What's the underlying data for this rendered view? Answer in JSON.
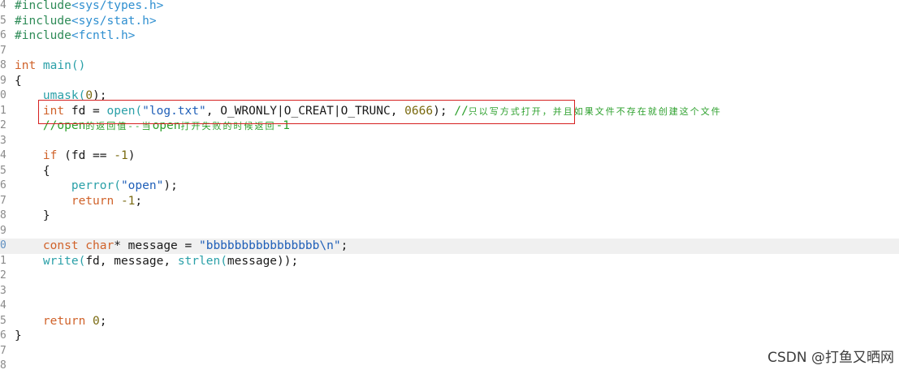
{
  "lines": [
    {
      "num": "4",
      "tokens": [
        {
          "t": "#include",
          "c": "pp"
        },
        {
          "t": "<sys/types.h>",
          "c": "hdr"
        }
      ]
    },
    {
      "num": "5",
      "tokens": [
        {
          "t": "#include",
          "c": "pp"
        },
        {
          "t": "<sys/stat.h>",
          "c": "hdr"
        }
      ]
    },
    {
      "num": "6",
      "tokens": [
        {
          "t": "#include",
          "c": "pp"
        },
        {
          "t": "<fcntl.h>",
          "c": "hdr"
        }
      ]
    },
    {
      "num": "7",
      "tokens": []
    },
    {
      "num": "8",
      "tokens": [
        {
          "t": "int",
          "c": "kw"
        },
        {
          "t": " main()",
          "c": "fn"
        }
      ]
    },
    {
      "num": "9",
      "tokens": [
        {
          "t": "{",
          "c": "id"
        }
      ]
    },
    {
      "num": "0",
      "tokens": [
        {
          "t": "    umask(",
          "c": "fn"
        },
        {
          "t": "0",
          "c": "num"
        },
        {
          "t": ");",
          "c": "id"
        }
      ]
    },
    {
      "num": "1",
      "tokens": [
        {
          "t": "    int",
          "c": "kw"
        },
        {
          "t": " fd = ",
          "c": "id"
        },
        {
          "t": "open(",
          "c": "fn"
        },
        {
          "t": "\"log.txt\"",
          "c": "str"
        },
        {
          "t": ", O_WRONLY|O_CREAT|O_TRUNC, ",
          "c": "id"
        },
        {
          "t": "0666",
          "c": "num"
        },
        {
          "t": "); ",
          "c": "id"
        },
        {
          "t": "//",
          "c": "cmt"
        },
        {
          "t": "只以写方式打开，并且如果文件不存在就创建这个文件",
          "c": "cmt-small"
        }
      ]
    },
    {
      "num": "2",
      "tokens": [
        {
          "t": "    //open",
          "c": "cmt"
        },
        {
          "t": "的返回值--当",
          "c": "cmt-small"
        },
        {
          "t": "open",
          "c": "cmt"
        },
        {
          "t": "打开失败的时候返回",
          "c": "cmt-small"
        },
        {
          "t": "-1",
          "c": "cmt"
        }
      ]
    },
    {
      "num": "3",
      "tokens": []
    },
    {
      "num": "4",
      "tokens": [
        {
          "t": "    if",
          "c": "kw"
        },
        {
          "t": " (fd == ",
          "c": "id"
        },
        {
          "t": "-1",
          "c": "num"
        },
        {
          "t": ")",
          "c": "id"
        }
      ]
    },
    {
      "num": "5",
      "tokens": [
        {
          "t": "    {",
          "c": "id"
        }
      ]
    },
    {
      "num": "6",
      "tokens": [
        {
          "t": "        perror(",
          "c": "fn"
        },
        {
          "t": "\"open\"",
          "c": "str"
        },
        {
          "t": ");",
          "c": "id"
        }
      ]
    },
    {
      "num": "7",
      "tokens": [
        {
          "t": "        return",
          "c": "kw"
        },
        {
          "t": " -1",
          "c": "num"
        },
        {
          "t": ";",
          "c": "id"
        }
      ]
    },
    {
      "num": "8",
      "tokens": [
        {
          "t": "    }",
          "c": "id"
        }
      ]
    },
    {
      "num": "9",
      "tokens": []
    },
    {
      "num": "0",
      "active": true,
      "tokens": [
        {
          "t": "    const char",
          "c": "kw"
        },
        {
          "t": "* message = ",
          "c": "id"
        },
        {
          "t": "\"bbbbbbbbbbbbbbbb\\n\"",
          "c": "str"
        },
        {
          "t": ";",
          "c": "id"
        }
      ]
    },
    {
      "num": "1",
      "tokens": [
        {
          "t": "    write(",
          "c": "fn"
        },
        {
          "t": "fd, message, ",
          "c": "id"
        },
        {
          "t": "strlen(",
          "c": "fn"
        },
        {
          "t": "message));",
          "c": "id"
        }
      ]
    },
    {
      "num": "2",
      "tokens": []
    },
    {
      "num": "3",
      "tokens": []
    },
    {
      "num": "4",
      "tokens": []
    },
    {
      "num": "5",
      "tokens": [
        {
          "t": "    return",
          "c": "kw"
        },
        {
          "t": " 0",
          "c": "num"
        },
        {
          "t": ";",
          "c": "id"
        }
      ]
    },
    {
      "num": "6",
      "tokens": [
        {
          "t": "}",
          "c": "id"
        }
      ]
    },
    {
      "num": "7",
      "tokens": []
    },
    {
      "num": "8",
      "tokens": []
    }
  ],
  "watermark": "CSDN @打鱼又晒网",
  "colors": {
    "preprocessor": "#2e8b57",
    "keyword": "#d0622a",
    "function": "#2aa0a8",
    "string": "#1f5fb8",
    "number": "#7a6a10",
    "comment": "#2ca02c",
    "highlight_border": "#d62020"
  }
}
